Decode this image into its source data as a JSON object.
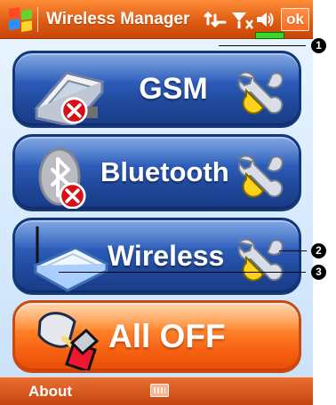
{
  "window": {
    "title": "Wireless Manager",
    "ok_label": "ok"
  },
  "status_icons": [
    {
      "name": "connectivity-icon"
    },
    {
      "name": "signal-icon"
    },
    {
      "name": "speaker-icon"
    },
    {
      "name": "battery-level"
    }
  ],
  "controls": {
    "gsm": {
      "label": "GSM",
      "status_icon": "error-x-icon",
      "settings_icon": "wrench-icon"
    },
    "bluetooth": {
      "label": "Bluetooth",
      "status_icon": "error-x-icon",
      "settings_icon": "wrench-icon"
    },
    "wireless": {
      "label": "Wireless",
      "settings_icon": "wrench-icon"
    },
    "all_off": {
      "label": "All OFF",
      "icon": "power-off-icon"
    }
  },
  "bottom_bar": {
    "about_label": "About",
    "keyboard_icon": "keyboard-icon"
  },
  "callouts": {
    "one": "1",
    "two": "2",
    "three": "3"
  },
  "colors": {
    "blue_panel": "#2f60bd",
    "orange_panel": "#f86414",
    "title_bar": "#dd5d12"
  }
}
